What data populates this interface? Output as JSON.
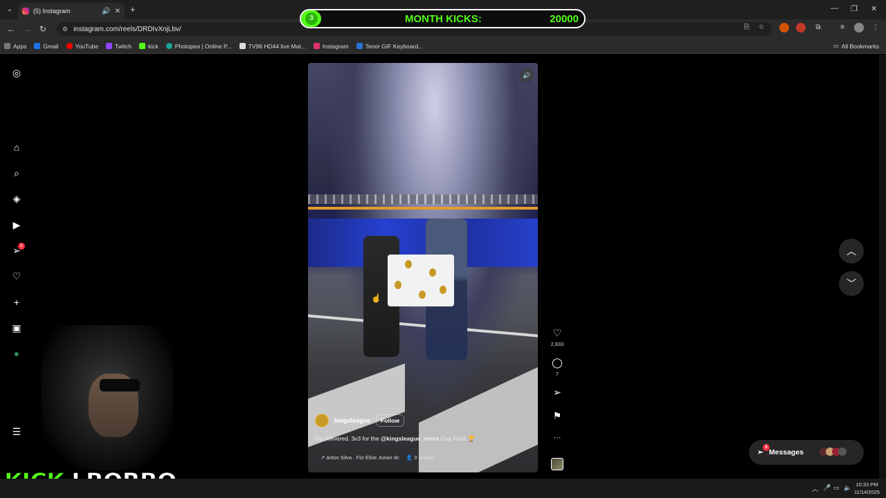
{
  "browser": {
    "tab_title": "(5) Instagram",
    "url": "instagram.com/reels/DRDIvXnjLbv/",
    "new_tab": "+",
    "bookmarks": [
      "Apps",
      "Gmail",
      "YouTube",
      "Twitch",
      "kick",
      "Photopea | Online P...",
      "TV96 HD44 live Mat...",
      "Instagram",
      "Tenor GIF Keyboard..."
    ],
    "all_bookmarks": "All Bookmarks"
  },
  "overlay": {
    "level": "3",
    "label": "MONTH KICKS:",
    "value": "20000",
    "progress": 0.07
  },
  "instagram": {
    "notifications_badge": "5",
    "reel": {
      "username": "kingsleague",
      "follow": "Follow",
      "caption_prefix": "He delivered. 3v3 for the ",
      "caption_mention": "@kingsleague_mena",
      "caption_suffix": " Cup Final 🏆",
      "music": "antos Silva · Für Elise  Junior dc",
      "people": "3 people",
      "likes": "2,833",
      "comments": "7",
      "more": "···"
    },
    "messages_label": "Messages",
    "messages_badge": "5"
  },
  "streamer": {
    "brand": "KICK",
    "name": "LBORBO"
  },
  "taskbar": {
    "time": "10:33 PM",
    "date": "11/14/2025"
  },
  "colors": {
    "kick_green": "#53fc18",
    "ig_badge": "#ff3040"
  }
}
